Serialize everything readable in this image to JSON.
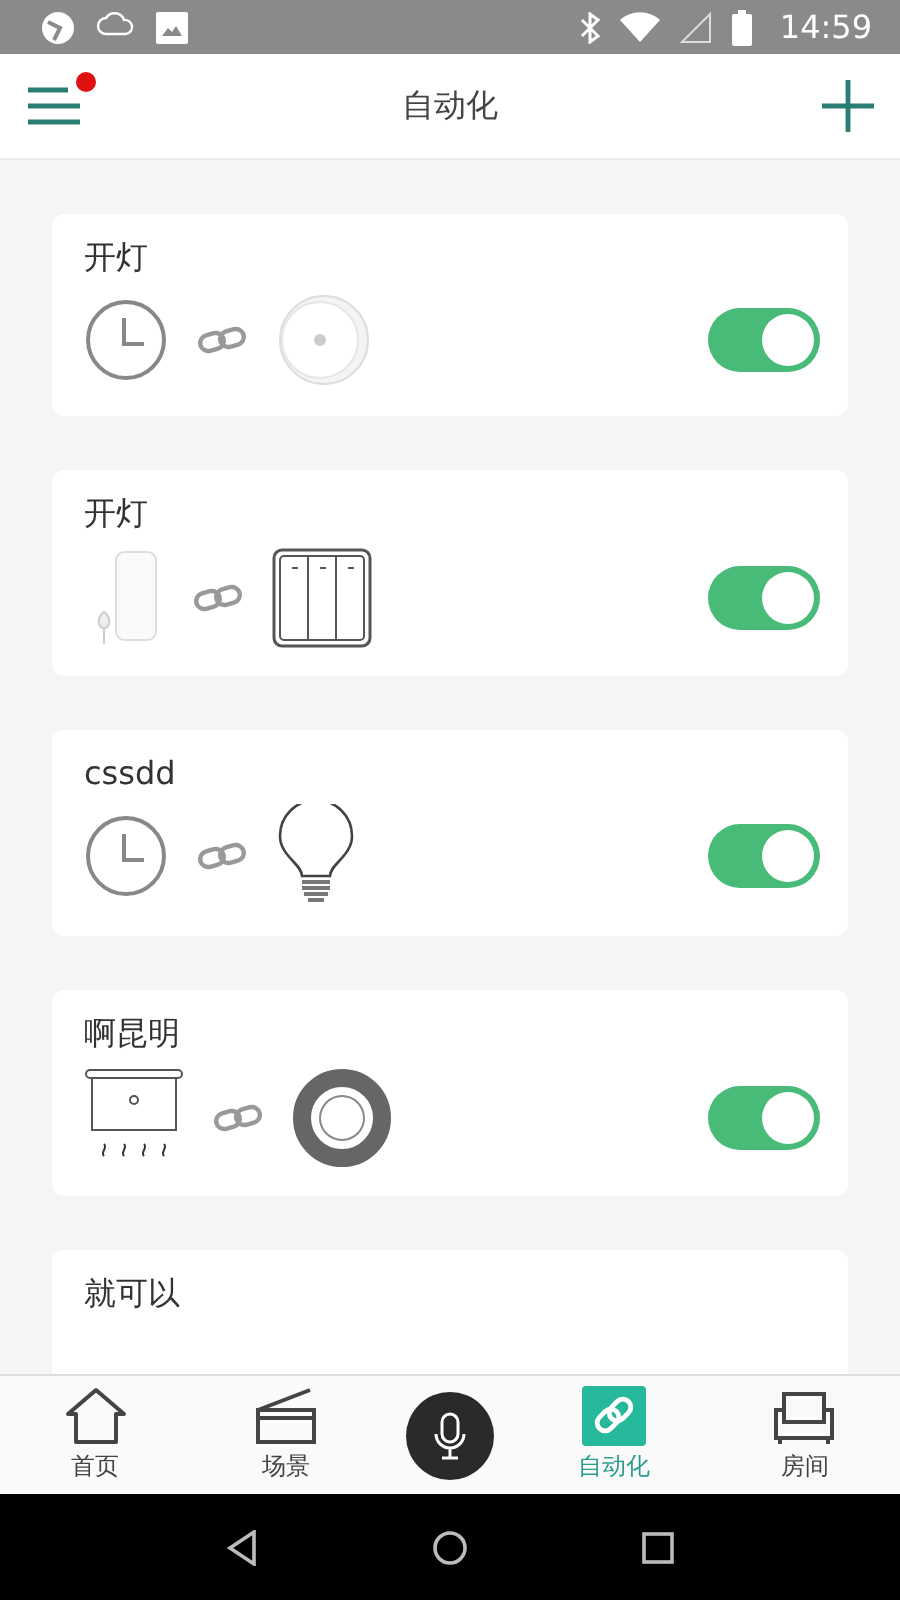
{
  "status_bar": {
    "time": "14:59"
  },
  "header": {
    "title": "自动化",
    "menu_badge": true
  },
  "automations": [
    {
      "name": "开灯",
      "on": true,
      "trigger": {
        "kind": "clock"
      },
      "target": {
        "kind": "smoke-sensor"
      }
    },
    {
      "name": "开灯",
      "on": true,
      "trigger": {
        "kind": "door-sensor"
      },
      "target": {
        "kind": "wall-switch"
      }
    },
    {
      "name": "cssdd",
      "on": true,
      "trigger": {
        "kind": "clock"
      },
      "target": {
        "kind": "bulb"
      }
    },
    {
      "name": "啊昆明",
      "on": true,
      "trigger": {
        "kind": "heater"
      },
      "target": {
        "kind": "ring-button"
      }
    },
    {
      "name": "就可以"
    }
  ],
  "bottom_nav": [
    {
      "kind": "home",
      "label": "首页",
      "selected": false
    },
    {
      "kind": "scene",
      "label": "场景",
      "selected": false
    },
    {
      "kind": "voice",
      "selected": false
    },
    {
      "kind": "automation",
      "label": "自动化",
      "selected": true
    },
    {
      "kind": "room",
      "label": "房间",
      "selected": false
    }
  ]
}
